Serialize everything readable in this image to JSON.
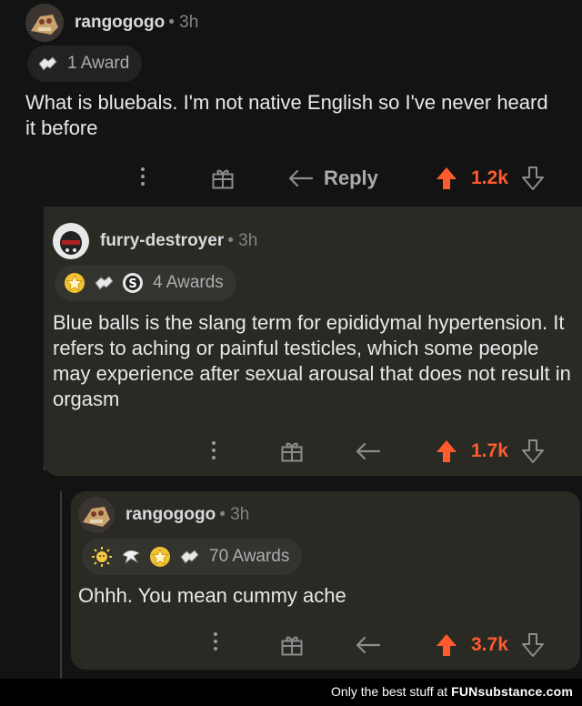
{
  "comments": [
    {
      "username": "rangogogo",
      "meta": "• 3h",
      "awards_label": "1 Award",
      "award_icons": [
        "handshake-award-icon"
      ],
      "text": "What is bluebals. I'm not native English so I've never heard it before",
      "reply_label": "Reply",
      "score": "1.2k"
    },
    {
      "username": "furry-destroyer",
      "meta": "• 3h",
      "awards_label": "4 Awards",
      "award_icons": [
        "gold-award-icon",
        "handshake-award-icon",
        "s-award-icon"
      ],
      "text": "Blue balls is the slang term for epididymal hypertension. It refers to aching or painful testicles, which some people may experience after sexual arousal that does not result in orgasm",
      "score": "1.7k"
    },
    {
      "username": "rangogogo",
      "meta": "• 3h",
      "awards_label": "70 Awards",
      "award_icons": [
        "sun-award-icon",
        "bird-award-icon",
        "gold-award-icon",
        "handshake-award-icon"
      ],
      "text": "Ohhh. You mean cummy ache",
      "score": "3.7k"
    }
  ],
  "watermark": {
    "prefix": "Only the best stuff at",
    "brand": "FUNsubstance.com"
  },
  "colors": {
    "background": "#131313",
    "reply_card": "#2a2a24",
    "upvote": "#ff5b2e",
    "muted": "#818384"
  }
}
